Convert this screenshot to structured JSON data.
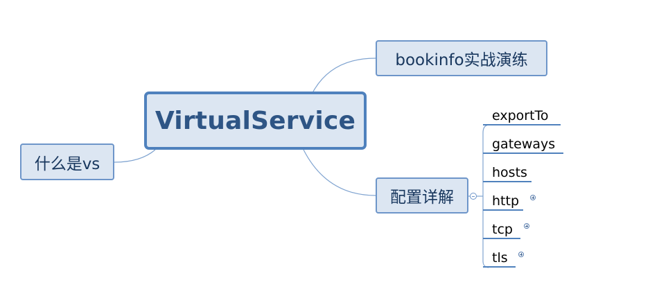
{
  "mindmap": {
    "root": {
      "label": "VirtualService"
    },
    "branches": {
      "bookinfo": {
        "label": "bookinfo实战演练"
      },
      "what": {
        "label": "什么是vs"
      },
      "config": {
        "label": "配置详解",
        "children": [
          {
            "label": "exportTo",
            "collapsed": false
          },
          {
            "label": "gateways",
            "collapsed": false
          },
          {
            "label": "hosts",
            "collapsed": false
          },
          {
            "label": "http",
            "collapsed": true
          },
          {
            "label": "tcp",
            "collapsed": true
          },
          {
            "label": "tls",
            "collapsed": true
          }
        ]
      }
    }
  },
  "colors": {
    "node_fill": "#dce6f2",
    "node_border": "#6d95c9",
    "root_border": "#4f81bd",
    "root_text": "#2e5585",
    "connector": "#7fa3d0"
  }
}
